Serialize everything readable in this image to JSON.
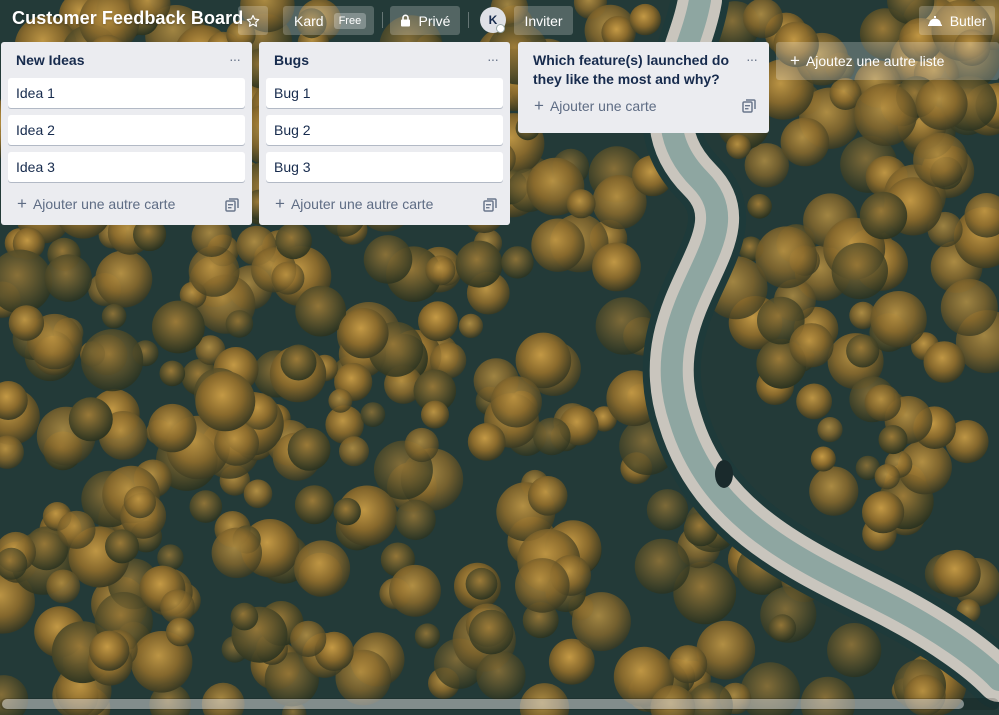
{
  "header": {
    "board_title": "Customer Feedback Board",
    "team_name": "Kard",
    "team_badge": "Free",
    "visibility_label": "Privé",
    "avatar_initial": "K",
    "invite_label": "Inviter",
    "butler_label": "Butler"
  },
  "lists": [
    {
      "title": "New Ideas",
      "cards": [
        "Idea 1",
        "Idea 2",
        "Idea 3"
      ],
      "add_card_label": "Ajouter une autre carte"
    },
    {
      "title": "Bugs",
      "cards": [
        "Bug 1",
        "Bug 2",
        "Bug 3"
      ],
      "add_card_label": "Ajouter une autre carte"
    },
    {
      "title": "Which feature(s) launched do they like the most and why?",
      "cards": [],
      "add_card_label": "Ajouter une carte"
    }
  ],
  "add_list_label": "Ajoutez une autre liste",
  "icons": {
    "star": "star-icon",
    "lock": "lock-icon",
    "butler": "butler-icon",
    "list_menu": "more-horizontal-icon",
    "plus": "plus-icon",
    "template": "card-template-icon"
  },
  "colors": {
    "list_bg": "#ebecf0",
    "card_bg": "#ffffff",
    "text_primary": "#172b4d",
    "text_secondary": "#5e6c84"
  }
}
